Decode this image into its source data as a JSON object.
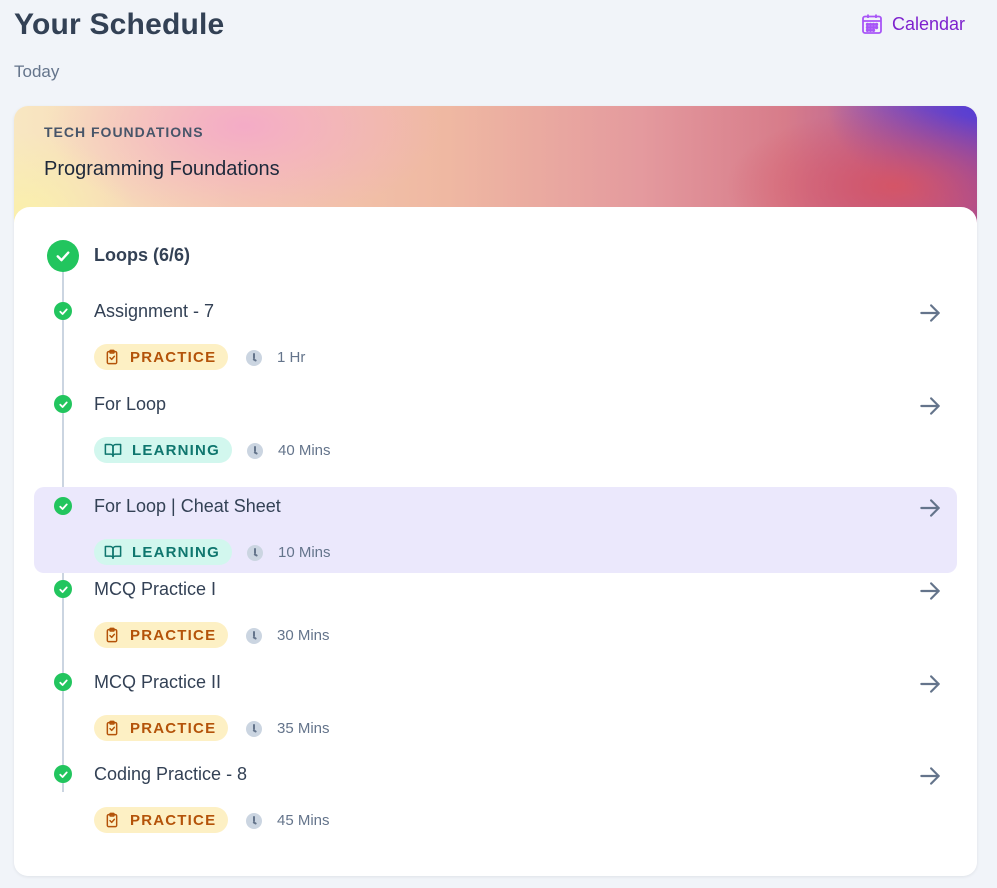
{
  "header": {
    "title": "Your Schedule",
    "subtitle": "Today",
    "calendar_label": "Calendar"
  },
  "course": {
    "category": "TECH FOUNDATIONS",
    "title": "Programming Foundations"
  },
  "module": {
    "title": "Loops (6/6)",
    "status": "completed"
  },
  "items": [
    {
      "title": "Assignment - 7",
      "type": "PRACTICE",
      "duration": "1 Hr",
      "completed": true,
      "active": false
    },
    {
      "title": "For Loop",
      "type": "LEARNING",
      "duration": "40 Mins",
      "completed": true,
      "active": false
    },
    {
      "title": "For Loop | Cheat Sheet",
      "type": "LEARNING",
      "duration": "10 Mins",
      "completed": true,
      "active": true
    },
    {
      "title": "MCQ Practice I",
      "type": "PRACTICE",
      "duration": "30 Mins",
      "completed": true,
      "active": false
    },
    {
      "title": "MCQ Practice II",
      "type": "PRACTICE",
      "duration": "35 Mins",
      "completed": true,
      "active": false
    },
    {
      "title": "Coding Practice - 8",
      "type": "PRACTICE",
      "duration": "45 Mins",
      "completed": true,
      "active": false
    }
  ],
  "icons": {
    "calendar": "calendar-icon",
    "practice": "clipboard-check-icon",
    "learning": "book-open-icon",
    "duration": "clock-icon",
    "open": "arrow-right-icon",
    "completed": "check-circle-icon"
  },
  "colors": {
    "accent": "#7e22ce",
    "success": "#22c55e",
    "practice_bg": "#fdf0c4",
    "practice_fg": "#b45309",
    "learning_bg": "#d2f7ee",
    "learning_fg": "#0f766e",
    "active_row": "#ebe8fc"
  }
}
